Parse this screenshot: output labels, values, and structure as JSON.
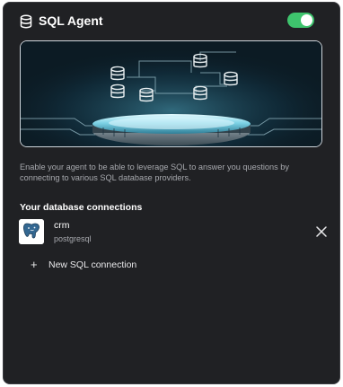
{
  "header": {
    "title": "SQL Agent",
    "enabled": true,
    "toggle_color": "#3ec46d"
  },
  "description": "Enable your agent to be able to leverage SQL to answer you questions by connecting to various SQL database providers.",
  "connections": {
    "section_title": "Your database connections",
    "items": [
      {
        "name": "crm",
        "type": "postgresql",
        "logo_icon": "postgresql-logo-icon",
        "logo_text": "PostgreSQL"
      }
    ],
    "new_connection_label": "New SQL connection"
  },
  "colors": {
    "panel_bg": "#202124",
    "accent_green": "#3ec46d",
    "muted_text": "#a7a9ae"
  }
}
